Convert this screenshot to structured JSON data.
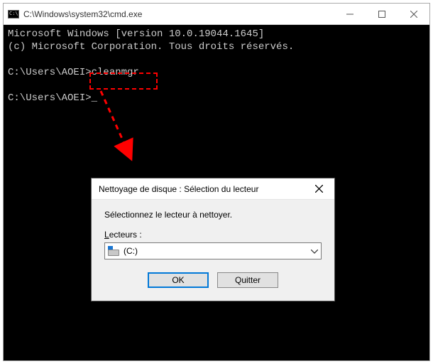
{
  "cmd": {
    "title": "C:\\Windows\\system32\\cmd.exe",
    "line1": "Microsoft Windows [version 10.0.19044.1645]",
    "line2": "(c) Microsoft Corporation. Tous droits réservés.",
    "prompt1_path": "C:\\Users\\AOEI>",
    "prompt1_cmd": "cleanmgr",
    "prompt2_path": "C:\\Users\\AOEI>",
    "cursor": "_"
  },
  "dialog": {
    "title": "Nettoyage de disque : Sélection du lecteur",
    "instruction": "Sélectionnez le lecteur à nettoyer.",
    "label_prefix": "L",
    "label_rest": "ecteurs :",
    "selected_drive": " (C:)",
    "ok_label": "OK",
    "quit_label": "Quitter"
  }
}
